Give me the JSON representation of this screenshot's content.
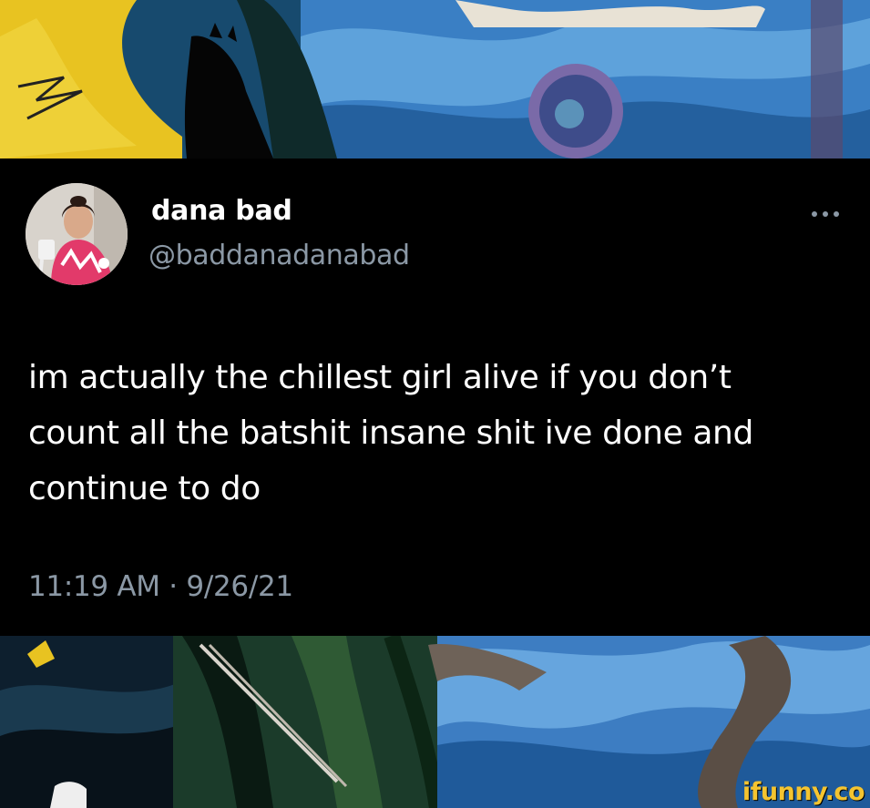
{
  "tweet": {
    "display_name": "dana bad",
    "handle": "@baddanadanabad",
    "text_lines": [
      "im actually the chillest girl alive if you don’t",
      "count all the batshit insane shit ive done and",
      "continue to do"
    ],
    "timestamp": "11:19 AM · 9/26/21"
  },
  "icons": {
    "more": "more-horizontal-icon",
    "avatar": "profile-photo"
  },
  "watermark": "ifunny.co",
  "colors": {
    "background": "#000000",
    "primary_text": "#ffffff",
    "secondary_text": "#8b98a5",
    "watermark": "#f4c430"
  }
}
